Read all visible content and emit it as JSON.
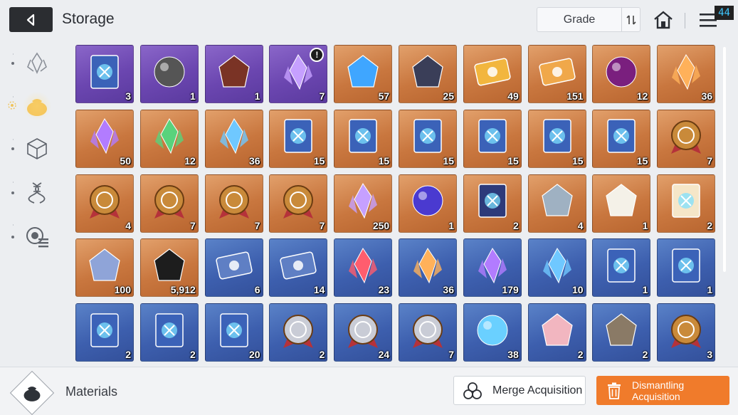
{
  "header": {
    "title": "Storage",
    "back_icon": "back-arrow-icon",
    "grade_label": "Grade",
    "fps": "44"
  },
  "sidebar": {
    "categories": [
      {
        "name": "crystal-category-icon",
        "active": false
      },
      {
        "name": "materials-bag-icon",
        "active": true
      },
      {
        "name": "cube-category-icon",
        "active": false
      },
      {
        "name": "dna-category-icon",
        "active": false
      },
      {
        "name": "gear-list-category-icon",
        "active": false
      }
    ]
  },
  "colors": {
    "purple": "#6b46b0",
    "orange": "#c9773f",
    "blue": "#3d5fae",
    "accent": "#f07b2b"
  },
  "items": [
    {
      "q": "3",
      "rarity": "purple",
      "icon": "emblem-book"
    },
    {
      "q": "1",
      "rarity": "purple",
      "icon": "dark-orb"
    },
    {
      "q": "1",
      "rarity": "purple",
      "icon": "red-rock"
    },
    {
      "q": "7",
      "rarity": "purple",
      "icon": "warning-crystal",
      "timer": true
    },
    {
      "q": "57",
      "rarity": "orange",
      "icon": "blue-creature"
    },
    {
      "q": "25",
      "rarity": "orange",
      "icon": "chip-board"
    },
    {
      "q": "49",
      "rarity": "orange",
      "icon": "gold-ticket"
    },
    {
      "q": "151",
      "rarity": "orange",
      "icon": "star-ticket"
    },
    {
      "q": "12",
      "rarity": "orange",
      "icon": "eye-orb"
    },
    {
      "q": "36",
      "rarity": "orange",
      "icon": "orange-crystal"
    },
    {
      "q": "50",
      "rarity": "orange",
      "icon": "purple-crystal"
    },
    {
      "q": "12",
      "rarity": "orange",
      "icon": "green-crystal"
    },
    {
      "q": "36",
      "rarity": "orange",
      "icon": "blue-crystal"
    },
    {
      "q": "15",
      "rarity": "orange",
      "icon": "sword-manual"
    },
    {
      "q": "15",
      "rarity": "orange",
      "icon": "shield-manual"
    },
    {
      "q": "15",
      "rarity": "orange",
      "icon": "eye-manual"
    },
    {
      "q": "15",
      "rarity": "orange",
      "icon": "bow-manual"
    },
    {
      "q": "15",
      "rarity": "orange",
      "icon": "bolt-manual"
    },
    {
      "q": "15",
      "rarity": "orange",
      "icon": "target-manual"
    },
    {
      "q": "7",
      "rarity": "orange",
      "icon": "cross-medal"
    },
    {
      "q": "4",
      "rarity": "orange",
      "icon": "shield-medal"
    },
    {
      "q": "7",
      "rarity": "orange",
      "icon": "x-medal"
    },
    {
      "q": "7",
      "rarity": "orange",
      "icon": "star-medal"
    },
    {
      "q": "7",
      "rarity": "orange",
      "icon": "globe-medal"
    },
    {
      "q": "250",
      "rarity": "orange",
      "icon": "gold-shards"
    },
    {
      "q": "1",
      "rarity": "orange",
      "icon": "violet-prism"
    },
    {
      "q": "2",
      "rarity": "orange",
      "icon": "star-book"
    },
    {
      "q": "4",
      "rarity": "orange",
      "icon": "spray-gun"
    },
    {
      "q": "1",
      "rarity": "orange",
      "icon": "letter"
    },
    {
      "q": "2",
      "rarity": "orange",
      "icon": "emblem-book-gold"
    },
    {
      "q": "100",
      "rarity": "orange",
      "icon": "music-scroll"
    },
    {
      "q": "5,912",
      "rarity": "orange",
      "icon": "black-flower"
    },
    {
      "q": "6",
      "rarity": "blue",
      "icon": "silver-ticket"
    },
    {
      "q": "14",
      "rarity": "blue",
      "icon": "compass-ticket"
    },
    {
      "q": "23",
      "rarity": "blue",
      "icon": "red-shard"
    },
    {
      "q": "36",
      "rarity": "blue",
      "icon": "orange-shard"
    },
    {
      "q": "179",
      "rarity": "blue",
      "icon": "purple-shard"
    },
    {
      "q": "10",
      "rarity": "blue",
      "icon": "blue-shard"
    },
    {
      "q": "1",
      "rarity": "blue",
      "icon": "sword-manual"
    },
    {
      "q": "1",
      "rarity": "blue",
      "icon": "shield-manual"
    },
    {
      "q": "2",
      "rarity": "blue",
      "icon": "bow-manual"
    },
    {
      "q": "2",
      "rarity": "blue",
      "icon": "bolt-manual"
    },
    {
      "q": "20",
      "rarity": "blue",
      "icon": "target-manual"
    },
    {
      "q": "2",
      "rarity": "blue",
      "icon": "silver-medal"
    },
    {
      "q": "24",
      "rarity": "blue",
      "icon": "silver-medal-x"
    },
    {
      "q": "7",
      "rarity": "blue",
      "icon": "silver-medal-star"
    },
    {
      "q": "38",
      "rarity": "blue",
      "icon": "ice-gem"
    },
    {
      "q": "2",
      "rarity": "blue",
      "icon": "cake"
    },
    {
      "q": "2",
      "rarity": "blue",
      "icon": "pocket-watch"
    },
    {
      "q": "3",
      "rarity": "blue",
      "icon": "gold-badge"
    }
  ],
  "footer": {
    "category_icon": "materials-bag-icon",
    "category_label": "Materials",
    "merge_label": "Merge Acquisition",
    "dismantle_label": "Dismantling Acquisition"
  }
}
